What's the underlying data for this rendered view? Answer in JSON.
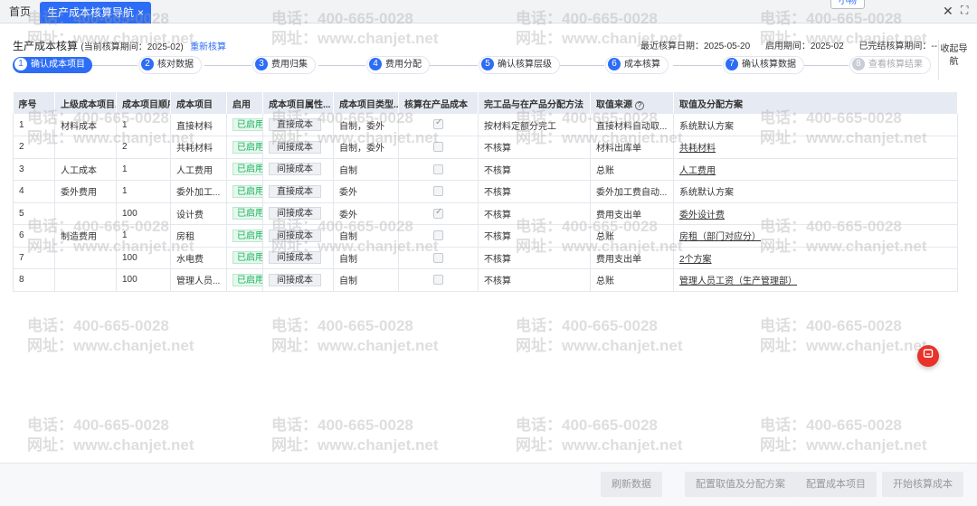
{
  "tabs": {
    "home": "首页",
    "active": "生产成本核算导航",
    "active_close": "×"
  },
  "helper_button": "小畅",
  "window_close": "✕",
  "window_expand": "⛶",
  "header": {
    "title": "生产成本核算",
    "period": "(当前核算期间：2025-02)",
    "recalc_link": "重新核算",
    "last_calc_date": "最近核算日期：2025-05-20",
    "enabled_period": "启用期间：2025-02",
    "completed_period": "已完结核算期间：--"
  },
  "collapse_nav": "收起导航",
  "steps": [
    {
      "num": "1",
      "label": "确认成本项目"
    },
    {
      "num": "2",
      "label": "核对数据"
    },
    {
      "num": "3",
      "label": "费用归集"
    },
    {
      "num": "4",
      "label": "费用分配"
    },
    {
      "num": "5",
      "label": "确认核算层级"
    },
    {
      "num": "6",
      "label": "成本核算"
    },
    {
      "num": "7",
      "label": "确认核算数据"
    },
    {
      "num": "8",
      "label": "查看核算结果"
    }
  ],
  "table": {
    "headers": [
      "序号",
      "上级成本项目...",
      "成本项目顺序",
      "成本项目",
      "启用",
      "成本项目属性...",
      "成本项目类型...",
      "核算在产品成本",
      "完工品与在产品分配方法",
      "取值来源",
      "取值及分配方案"
    ],
    "rows": [
      {
        "no": "1",
        "parent": "材料成本",
        "order": "1",
        "item": "直接材料",
        "enabled": "已启用",
        "attr": "直接成本",
        "type": "自制，委外",
        "wip": true,
        "method": "按材料定额分完工",
        "source": "直接材料自动取...",
        "plan": "系统默认方案"
      },
      {
        "no": "2",
        "parent": "",
        "order": "2",
        "item": "共耗材料",
        "enabled": "已启用",
        "attr": "间接成本",
        "type": "自制，委外",
        "wip": false,
        "method": "不核算",
        "source": "材料出库单",
        "plan": "共耗材料"
      },
      {
        "no": "3",
        "parent": "人工成本",
        "order": "1",
        "item": "人工费用",
        "enabled": "已启用",
        "attr": "间接成本",
        "type": "自制",
        "wip": false,
        "method": "不核算",
        "source": "总账",
        "plan": "人工费用"
      },
      {
        "no": "4",
        "parent": "委外费用",
        "order": "1",
        "item": "委外加工...",
        "enabled": "已启用",
        "attr": "直接成本",
        "type": "委外",
        "wip": false,
        "method": "不核算",
        "source": "委外加工费自动...",
        "plan": "系统默认方案"
      },
      {
        "no": "5",
        "parent": "",
        "order": "100",
        "item": "设计费",
        "enabled": "已启用",
        "attr": "间接成本",
        "type": "委外",
        "wip": true,
        "method": "不核算",
        "source": "费用支出单",
        "plan": "委外设计费"
      },
      {
        "no": "6",
        "parent": "制造费用",
        "order": "1",
        "item": "房租",
        "enabled": "已启用",
        "attr": "间接成本",
        "type": "自制",
        "wip": false,
        "method": "不核算",
        "source": "总账",
        "plan": "房租（部门对应分）"
      },
      {
        "no": "7",
        "parent": "",
        "order": "100",
        "item": "水电费",
        "enabled": "已启用",
        "attr": "间接成本",
        "type": "自制",
        "wip": false,
        "method": "不核算",
        "source": "费用支出单",
        "plan": "2个方案"
      },
      {
        "no": "8",
        "parent": "",
        "order": "100",
        "item": "管理人员...",
        "enabled": "已启用",
        "attr": "间接成本",
        "type": "自制",
        "wip": false,
        "method": "不核算",
        "source": "总账",
        "plan": "管理人员工资（生产管理部）"
      }
    ]
  },
  "footer": {
    "refresh": "刷新数据",
    "config_plan": "配置取值及分配方案",
    "config_items": "配置成本项目",
    "start": "开始核算成本"
  },
  "watermark": {
    "phone": "电话：400-665-0028",
    "site": "网址：www.chanjet.net"
  },
  "colors": {
    "primary": "#2d6df6",
    "enabled_green": "#19b35a",
    "float_red": "#e8332a"
  }
}
